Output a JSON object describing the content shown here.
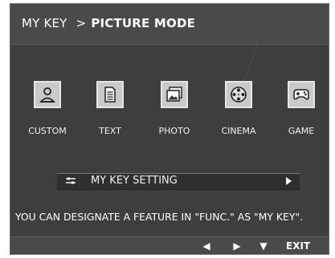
{
  "title": {
    "prefix": "MY KEY",
    "separator": ">",
    "mode": "PICTURE MODE"
  },
  "modes": [
    {
      "label": "CUSTOM",
      "icon": "person-icon"
    },
    {
      "label": "TEXT",
      "icon": "document-icon"
    },
    {
      "label": "PHOTO",
      "icon": "photo-icon"
    },
    {
      "label": "CINEMA",
      "icon": "film-reel-icon"
    },
    {
      "label": "GAME",
      "icon": "gamepad-icon"
    }
  ],
  "setting": {
    "label": "MY KEY SETTING",
    "icon": "settings-sliders-icon",
    "arrow": "▶"
  },
  "hint": "YOU CAN DESIGNATE A FEATURE IN \"FUNC.\" AS \"MY KEY\".",
  "nav": {
    "left": "◀",
    "right": "▶",
    "down": "▼",
    "exit": "EXIT"
  },
  "colors": {
    "panel": "#3e3e3e",
    "title_bar": "#4a4a4a",
    "icon_box": "#c9c9c9",
    "text": "#ffffff"
  }
}
